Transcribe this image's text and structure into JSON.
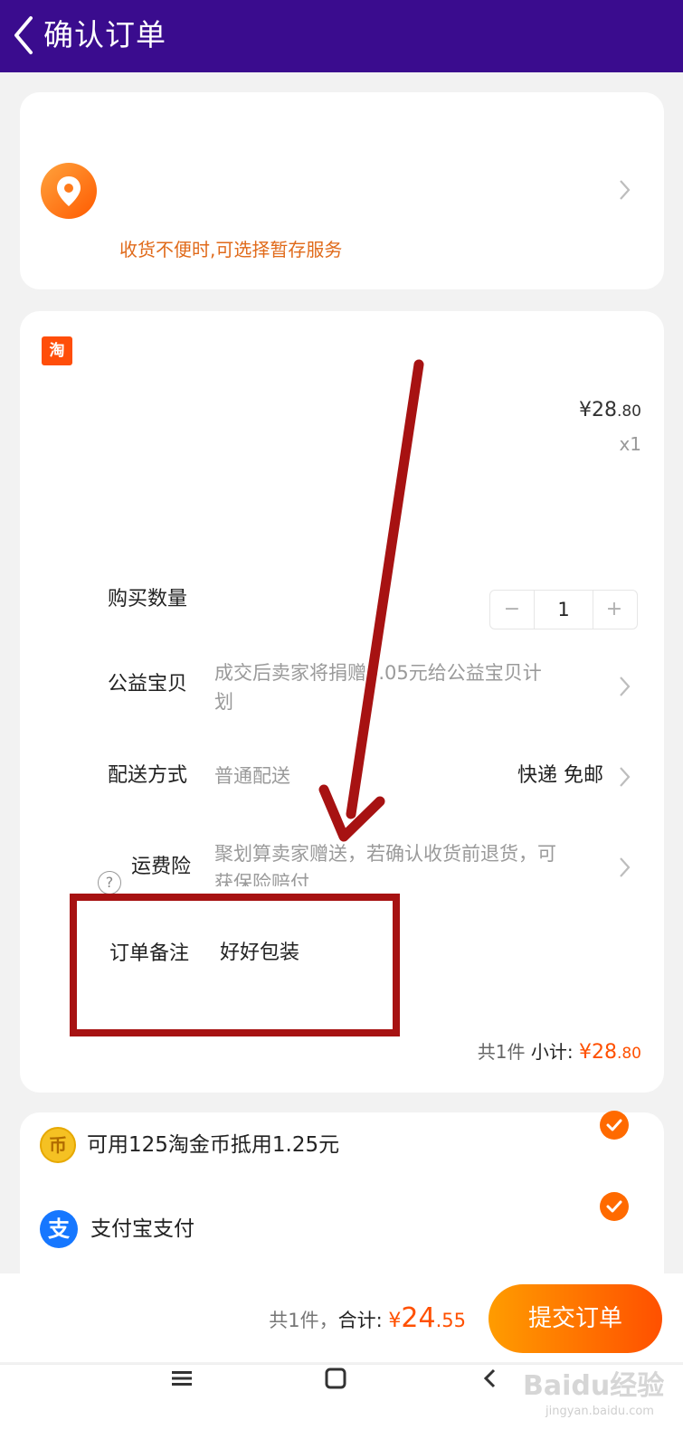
{
  "header": {
    "title": "确认订单"
  },
  "address": {
    "tip": "收货不便时,可选择暂存服务"
  },
  "shop": {
    "logo_char": "淘",
    "item": {
      "price_int": "¥28",
      "price_dec": ".80",
      "quantity_text": "x1"
    }
  },
  "rows": {
    "quantity": {
      "label": "购买数量",
      "minus": "−",
      "value": "1",
      "plus": "+"
    },
    "charity": {
      "label": "公益宝贝",
      "value_line1": "成交后卖家将捐赠0.05元给公益宝贝计",
      "value_line2": "划"
    },
    "delivery": {
      "label": "配送方式",
      "value": "普通配送",
      "option": "快递 免邮"
    },
    "insurance": {
      "label": "运费险",
      "value_line1": "聚划算卖家赠送，若确认收货前退货，可",
      "value_line2": "获保险赔付"
    },
    "note": {
      "label": "订单备注",
      "value": "好好包装"
    }
  },
  "subtotal": {
    "count": "共1件",
    "label": "小计:",
    "amount_int": "¥28",
    "amount_dec": ".80"
  },
  "payment": {
    "coin_label": "可用125淘金币抵用1.25元",
    "coin_icon_char": "币",
    "alipay_label": "支付宝支付",
    "alipay_icon_char": "支"
  },
  "footer": {
    "count": "共1件，",
    "total_label": "合计:",
    "yen": "¥",
    "amount_int": "24",
    "amount_dec": ".55",
    "submit_label": "提交订单"
  },
  "watermark": {
    "main": "Baidu经验",
    "sub": "jingyan.baidu.com"
  },
  "colors": {
    "header_bg": "#3a0c8e",
    "accent": "#ff5000",
    "annotation_red": "#a71212"
  },
  "icons": [
    "back-arrow-icon",
    "location-pin-icon",
    "chevron-right-icon",
    "taobao-logo-icon",
    "help-icon",
    "coin-icon",
    "alipay-icon",
    "check-icon",
    "menu-icon",
    "home-icon",
    "back-nav-icon"
  ]
}
